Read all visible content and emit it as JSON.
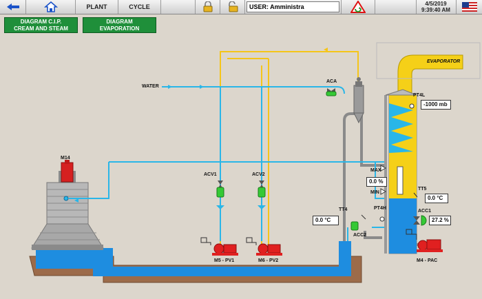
{
  "toolbar": {
    "back_icon": "arrow-left-icon",
    "home_icon": "home-icon",
    "plant_label": "PLANT",
    "cycle_label": "CYCLE",
    "lock_icon": "padlock-closed-icon",
    "unlock_icon": "padlock-open-icon",
    "user_label": "USER:  Amministra",
    "alarm_icon": "warning-triangle-icon",
    "date": "4/5/2019",
    "time": "9:39:40 AM",
    "flag_icon": "us-flag-icon"
  },
  "nav_buttons": {
    "cip_line1": "DIAGRAM C.I.P.",
    "cip_line2": "CREAM AND STEAM",
    "evap_line1": "DIAGRAM",
    "evap_line2": "EVAPORATION"
  },
  "labels": {
    "water": "WATER",
    "aca": "ACA",
    "evaporator": "EVAPORATOR",
    "pt4l": "PT4L",
    "m14": "M14",
    "acv1": "ACV1",
    "acv2": "ACV2",
    "max": "MAX",
    "min": "MIN",
    "tt5": "TT5",
    "tt4": "TT4",
    "pt4h": "PT4H",
    "acc1": "ACC1",
    "acc2": "ACC2",
    "m5": "M5 - PV1",
    "m6": "M6 - PV2",
    "m4": "M4 - PAC"
  },
  "values": {
    "pt4l": "-1000 mb",
    "level": "0.0 %",
    "tt5": "0.0 °C",
    "tt4": "0.0 °C",
    "acc1": "27.2 %"
  },
  "colors": {
    "water_line": "#29b6e8",
    "product_line": "#f5c518",
    "pipe_gray": "#8a8a8a",
    "tank_water": "#1e8de0",
    "motor_red": "#e02020",
    "valve_green": "#35c935",
    "button_green": "#1f8f3a"
  }
}
